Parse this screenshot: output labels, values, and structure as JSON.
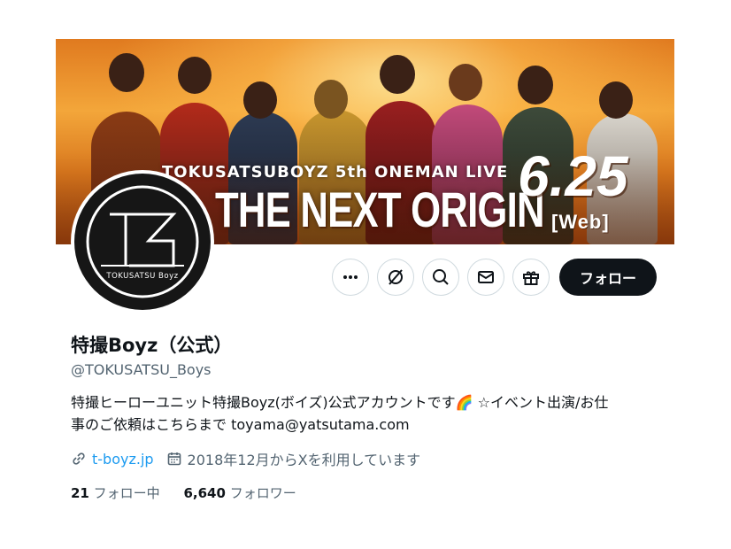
{
  "banner": {
    "subtitle": "TOKUSATSUBOYZ 5th ONEMAN LIVE",
    "title": "THE NEXT ORIGIN",
    "date": "6.25",
    "web_label": "[Web]"
  },
  "avatar": {
    "label": "TOKUSATSU Boyz",
    "monogram": "TB"
  },
  "actions": {
    "more_icon": "more-icon",
    "grok_icon": "grok-icon",
    "search_icon": "search-icon",
    "message_icon": "mail-icon",
    "gift_icon": "gift-icon",
    "follow_label": "フォロー"
  },
  "profile": {
    "name": "特撮Boyz（公式）",
    "handle": "@TOKUSATSU_Boys",
    "bio_line1": "特撮ヒーローユニット特撮Boyz(ボイズ)公式アカウントです🌈 ☆イベント出演/お仕",
    "bio_line2": "事のご依頼はこちらまで toyama@yatsutama.com",
    "website": "t-boyz.jp",
    "joined": "2018年12月からXを利用しています",
    "following_count": "21",
    "following_label": "フォロー中",
    "followers_count": "6,640",
    "followers_label": "フォロワー"
  },
  "colors": {
    "accent": "#1d9bf0",
    "text": "#0f1419",
    "secondary": "#536471",
    "border": "#cfd9de"
  }
}
